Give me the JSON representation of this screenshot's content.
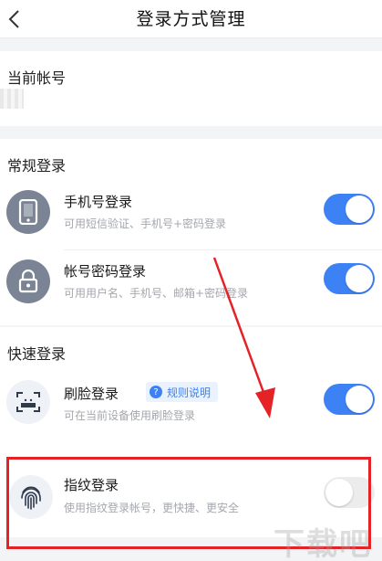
{
  "header": {
    "title": "登录方式管理",
    "back_icon": "chevron-left-icon"
  },
  "account": {
    "section_title": "当前帐号"
  },
  "regular_login": {
    "section_title": "常规登录",
    "items": [
      {
        "icon": "phone-icon",
        "title": "手机号登录",
        "description": "可用短信验证、手机号+密码登录",
        "enabled": true
      },
      {
        "icon": "lock-icon",
        "title": "帐号密码登录",
        "description": "可用用户名、手机号、邮箱+密码登录",
        "enabled": true
      }
    ]
  },
  "quick_login": {
    "section_title": "快速登录",
    "items": [
      {
        "icon": "face-scan-icon",
        "title": "刷脸登录",
        "badge": "规则说明",
        "description": "可在当前设备使用刷脸登录",
        "enabled": true
      },
      {
        "icon": "fingerprint-icon",
        "title": "指纹登录",
        "description": "使用指纹登录帐号，更快捷、更安全",
        "enabled": false
      }
    ]
  },
  "colors": {
    "accent": "#3d82f5",
    "highlight": "#e52226",
    "background": "#f3f4f6"
  }
}
